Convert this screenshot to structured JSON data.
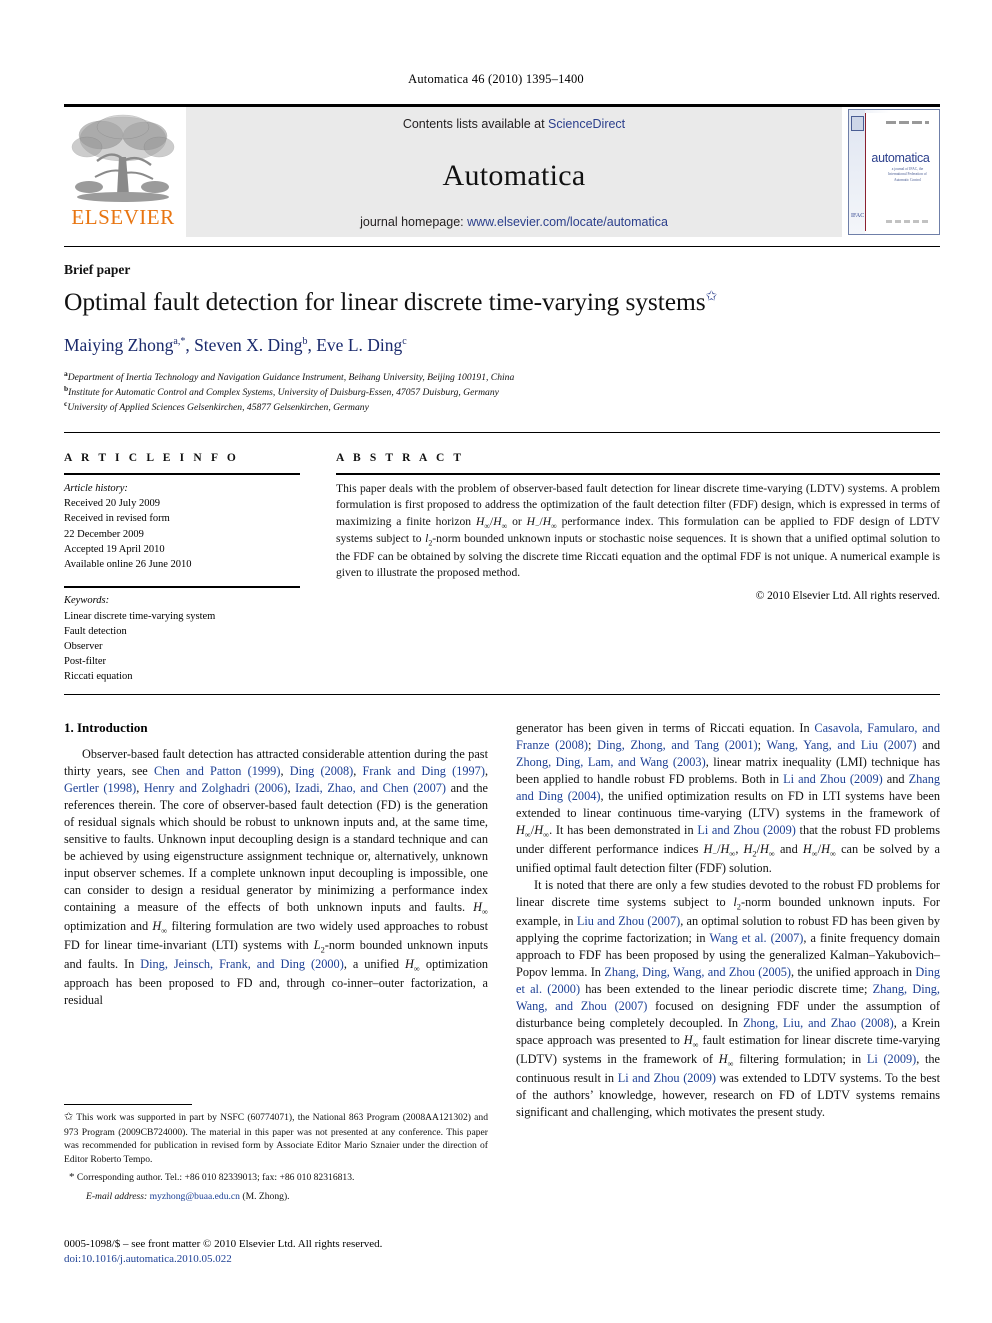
{
  "running_head": "Automatica 46 (2010) 1395–1400",
  "masthead": {
    "publisher_name": "ELSEVIER",
    "contents_prefix": "Contents lists available at ",
    "contents_link": "ScienceDirect",
    "journal_title": "Automatica",
    "homepage_prefix": "journal homepage: ",
    "homepage_url": "www.elsevier.com/locate/automatica",
    "cover_word": "automatica",
    "cover_sub": "a journal of IFAC, the International Federation of Automatic Control"
  },
  "article": {
    "type_label": "Brief paper",
    "title": "Optimal fault detection for linear discrete time-varying systems",
    "title_footnote_marker": "✩",
    "authors_html": "Maiying Zhong<sup>a,*</sup>, Steven X. Ding<sup>b</sup>, Eve L. Ding<sup>c</sup>",
    "affiliations": [
      {
        "marker": "a",
        "text": "Department of Inertia Technology and Navigation Guidance Instrument, Beihang University, Beijing 100191, China"
      },
      {
        "marker": "b",
        "text": "Institute for Automatic Control and Complex Systems, University of Duisburg-Essen, 47057 Duisburg, Germany"
      },
      {
        "marker": "c",
        "text": "University of Applied Sciences Gelsenkirchen, 45877 Gelsenkirchen, Germany"
      }
    ]
  },
  "article_info": {
    "heading": "A R T I C L E    I N F O",
    "history_label": "Article history:",
    "history": [
      "Received 20 July 2009",
      "Received in revised form",
      "22 December 2009",
      "Accepted 19 April 2010",
      "Available online 26 June 2010"
    ],
    "keywords_label": "Keywords:",
    "keywords": [
      "Linear discrete time-varying system",
      "Fault detection",
      "Observer",
      "Post-filter",
      "Riccati equation"
    ]
  },
  "abstract": {
    "heading": "A B S T R A C T",
    "body_html": "This paper deals with the problem of observer-based fault detection for linear discrete time-varying (LDTV) systems. A problem formulation is first proposed to address the optimization of the fault detection filter (FDF) design, which is expressed in terms of maximizing a finite horizon <span class=\"mathcal\">H</span><span class=\"sub\">∞</span>/<span class=\"mathcal\">H</span><span class=\"sub\">∞</span> or <span class=\"mathcal\">H</span><span class=\"sub\">−</span>/<span class=\"mathcal\">H</span><span class=\"sub\">∞</span> performance index. This formulation can be applied to FDF design of LDTV systems subject to <i>l</i><span class=\"sub\">2</span>-norm bounded unknown inputs or stochastic noise sequences. It is shown that a unified optimal solution to the FDF can be obtained by solving the discrete time Riccati equation and the optimal FDF is not unique. A numerical example is given to illustrate the proposed method.",
    "copyright": "© 2010 Elsevier Ltd. All rights reserved."
  },
  "body": {
    "section_title": "1. Introduction",
    "left_paragraphs_html": [
      "Observer-based fault detection has attracted considerable attention during the past thirty years, see <span class=\"cite\">Chen and Patton (1999)</span>, <span class=\"cite\">Ding (2008)</span>, <span class=\"cite\">Frank and Ding (1997)</span>, <span class=\"cite\">Gertler (1998)</span>, <span class=\"cite\">Henry and Zolghadri (2006)</span>, <span class=\"cite\">Izadi, Zhao, and Chen (2007)</span> and the references therein. The core of observer-based fault detection (FD) is the generation of residual signals which should be robust to unknown inputs and, at the same time, sensitive to faults. Unknown input decoupling design is a standard technique and can be achieved by using eigenstructure assignment technique or, alternatively, unknown input observer schemes. If a complete unknown input decoupling is impossible, one can consider to design a residual generator by minimizing a performance index containing a measure of the effects of both unknown inputs and faults. <span class=\"mathcal\">H</span><span class=\"sub\">∞</span> optimization and <span class=\"mathcal\">H</span><span class=\"sub\">∞</span> filtering formulation are two widely used approaches to robust FD for linear time-invariant (LTI) systems with <span class=\"mathcal\">L</span><span class=\"sub\">2</span>-norm bounded unknown inputs and faults. In <span class=\"cite\">Ding, Jeinsch, Frank, and Ding (2000)</span>, a unified <span class=\"mathcal\">H</span><span class=\"sub\">∞</span> optimization approach has been proposed to FD and, through co-inner–outer factorization, a residual"
    ],
    "right_paragraphs_html": [
      "generator has been given in terms of Riccati equation. In <span class=\"cite\">Casavola, Famularo, and Franze (2008)</span>; <span class=\"cite\">Ding, Zhong, and Tang (2001)</span>; <span class=\"cite\">Wang, Yang, and Liu (2007)</span> and <span class=\"cite\">Zhong, Ding, Lam, and Wang (2003)</span>, linear matrix inequality (LMI) technique has been applied to handle robust FD problems. Both in <span class=\"cite\">Li and Zhou (2009)</span> and <span class=\"cite\">Zhang and Ding (2004)</span>, the unified optimization results on FD in LTI systems have been extended to linear continuous time-varying (LTV) systems in the framework of <span class=\"mathcal\">H</span><span class=\"sub\">∞</span>/<span class=\"mathcal\">H</span><span class=\"sub\">∞</span>. It has been demonstrated in <span class=\"cite\">Li and Zhou (2009)</span> that the robust FD problems under different performance indices <span class=\"mathcal\">H</span><span class=\"sub\">−</span>/<span class=\"mathcal\">H</span><span class=\"sub\">∞</span>, <span class=\"mathcal\">H</span><span class=\"sub\">2</span>/<span class=\"mathcal\">H</span><span class=\"sub\">∞</span> and <span class=\"mathcal\">H</span><span class=\"sub\">∞</span>/<span class=\"mathcal\">H</span><span class=\"sub\">∞</span> can be solved by a unified optimal fault detection filter (FDF) solution.",
      "It is noted that there are only a few studies devoted to the robust FD problems for linear discrete time systems subject to <i>l</i><span class=\"sub\">2</span>-norm bounded unknown inputs. For example, in <span class=\"cite\">Liu and Zhou (2007)</span>, an optimal solution to robust FD has been given by applying the coprime factorization; in <span class=\"cite\">Wang et al. (2007)</span>, a finite frequency domain approach to FDF has been proposed by using the generalized Kalman–Yakubovich–Popov lemma. In <span class=\"cite\">Zhang, Ding, Wang, and Zhou (2005)</span>, the unified approach in <span class=\"cite\">Ding et al. (2000)</span> has been extended to the linear periodic discrete time; <span class=\"cite\">Zhang, Ding, Wang, and Zhou (2007)</span> focused on designing FDF under the assumption of disturbance being completely decoupled. In <span class=\"cite\">Zhong, Liu, and Zhao (2008)</span>, a Krein space approach was presented to <span class=\"mathcal\">H</span><span class=\"sub\">∞</span> fault estimation for linear discrete time-varying (LDTV) systems in the framework of <span class=\"mathcal\">H</span><span class=\"sub\">∞</span> filtering formulation; in <span class=\"cite\">Li (2009)</span>, the continuous result in <span class=\"cite\">Li and Zhou (2009)</span> was extended to LDTV systems. To the best of the authors’ knowledge, however, research on FD of LDTV systems remains significant and challenging, which motivates the present study."
    ]
  },
  "footnotes": {
    "funding_html": "<span class=\"marker\">✩</span>  This work was supported in part by NSFC (60774071), the National 863 Program (2008AA121302) and 973 Program (2009CB724000). The material in this paper was not presented at any conference. This paper was recommended for publication in revised form by Associate Editor Mario Sznaier under the direction of Editor Roberto Tempo.",
    "corresponding_html": "<span class=\"marker\">*</span>  Corresponding author. Tel.: +86 010 82339013; fax: +86 010 82316813.",
    "email_label": "E-mail address:",
    "email": "myzhong@buaa.edu.cn",
    "email_suffix": "(M. Zhong)."
  },
  "imprint": {
    "issn_line": "0005-1098/$ – see front matter © 2010 Elsevier Ltd. All rights reserved.",
    "doi_line": "doi:10.1016/j.automatica.2010.05.022"
  }
}
